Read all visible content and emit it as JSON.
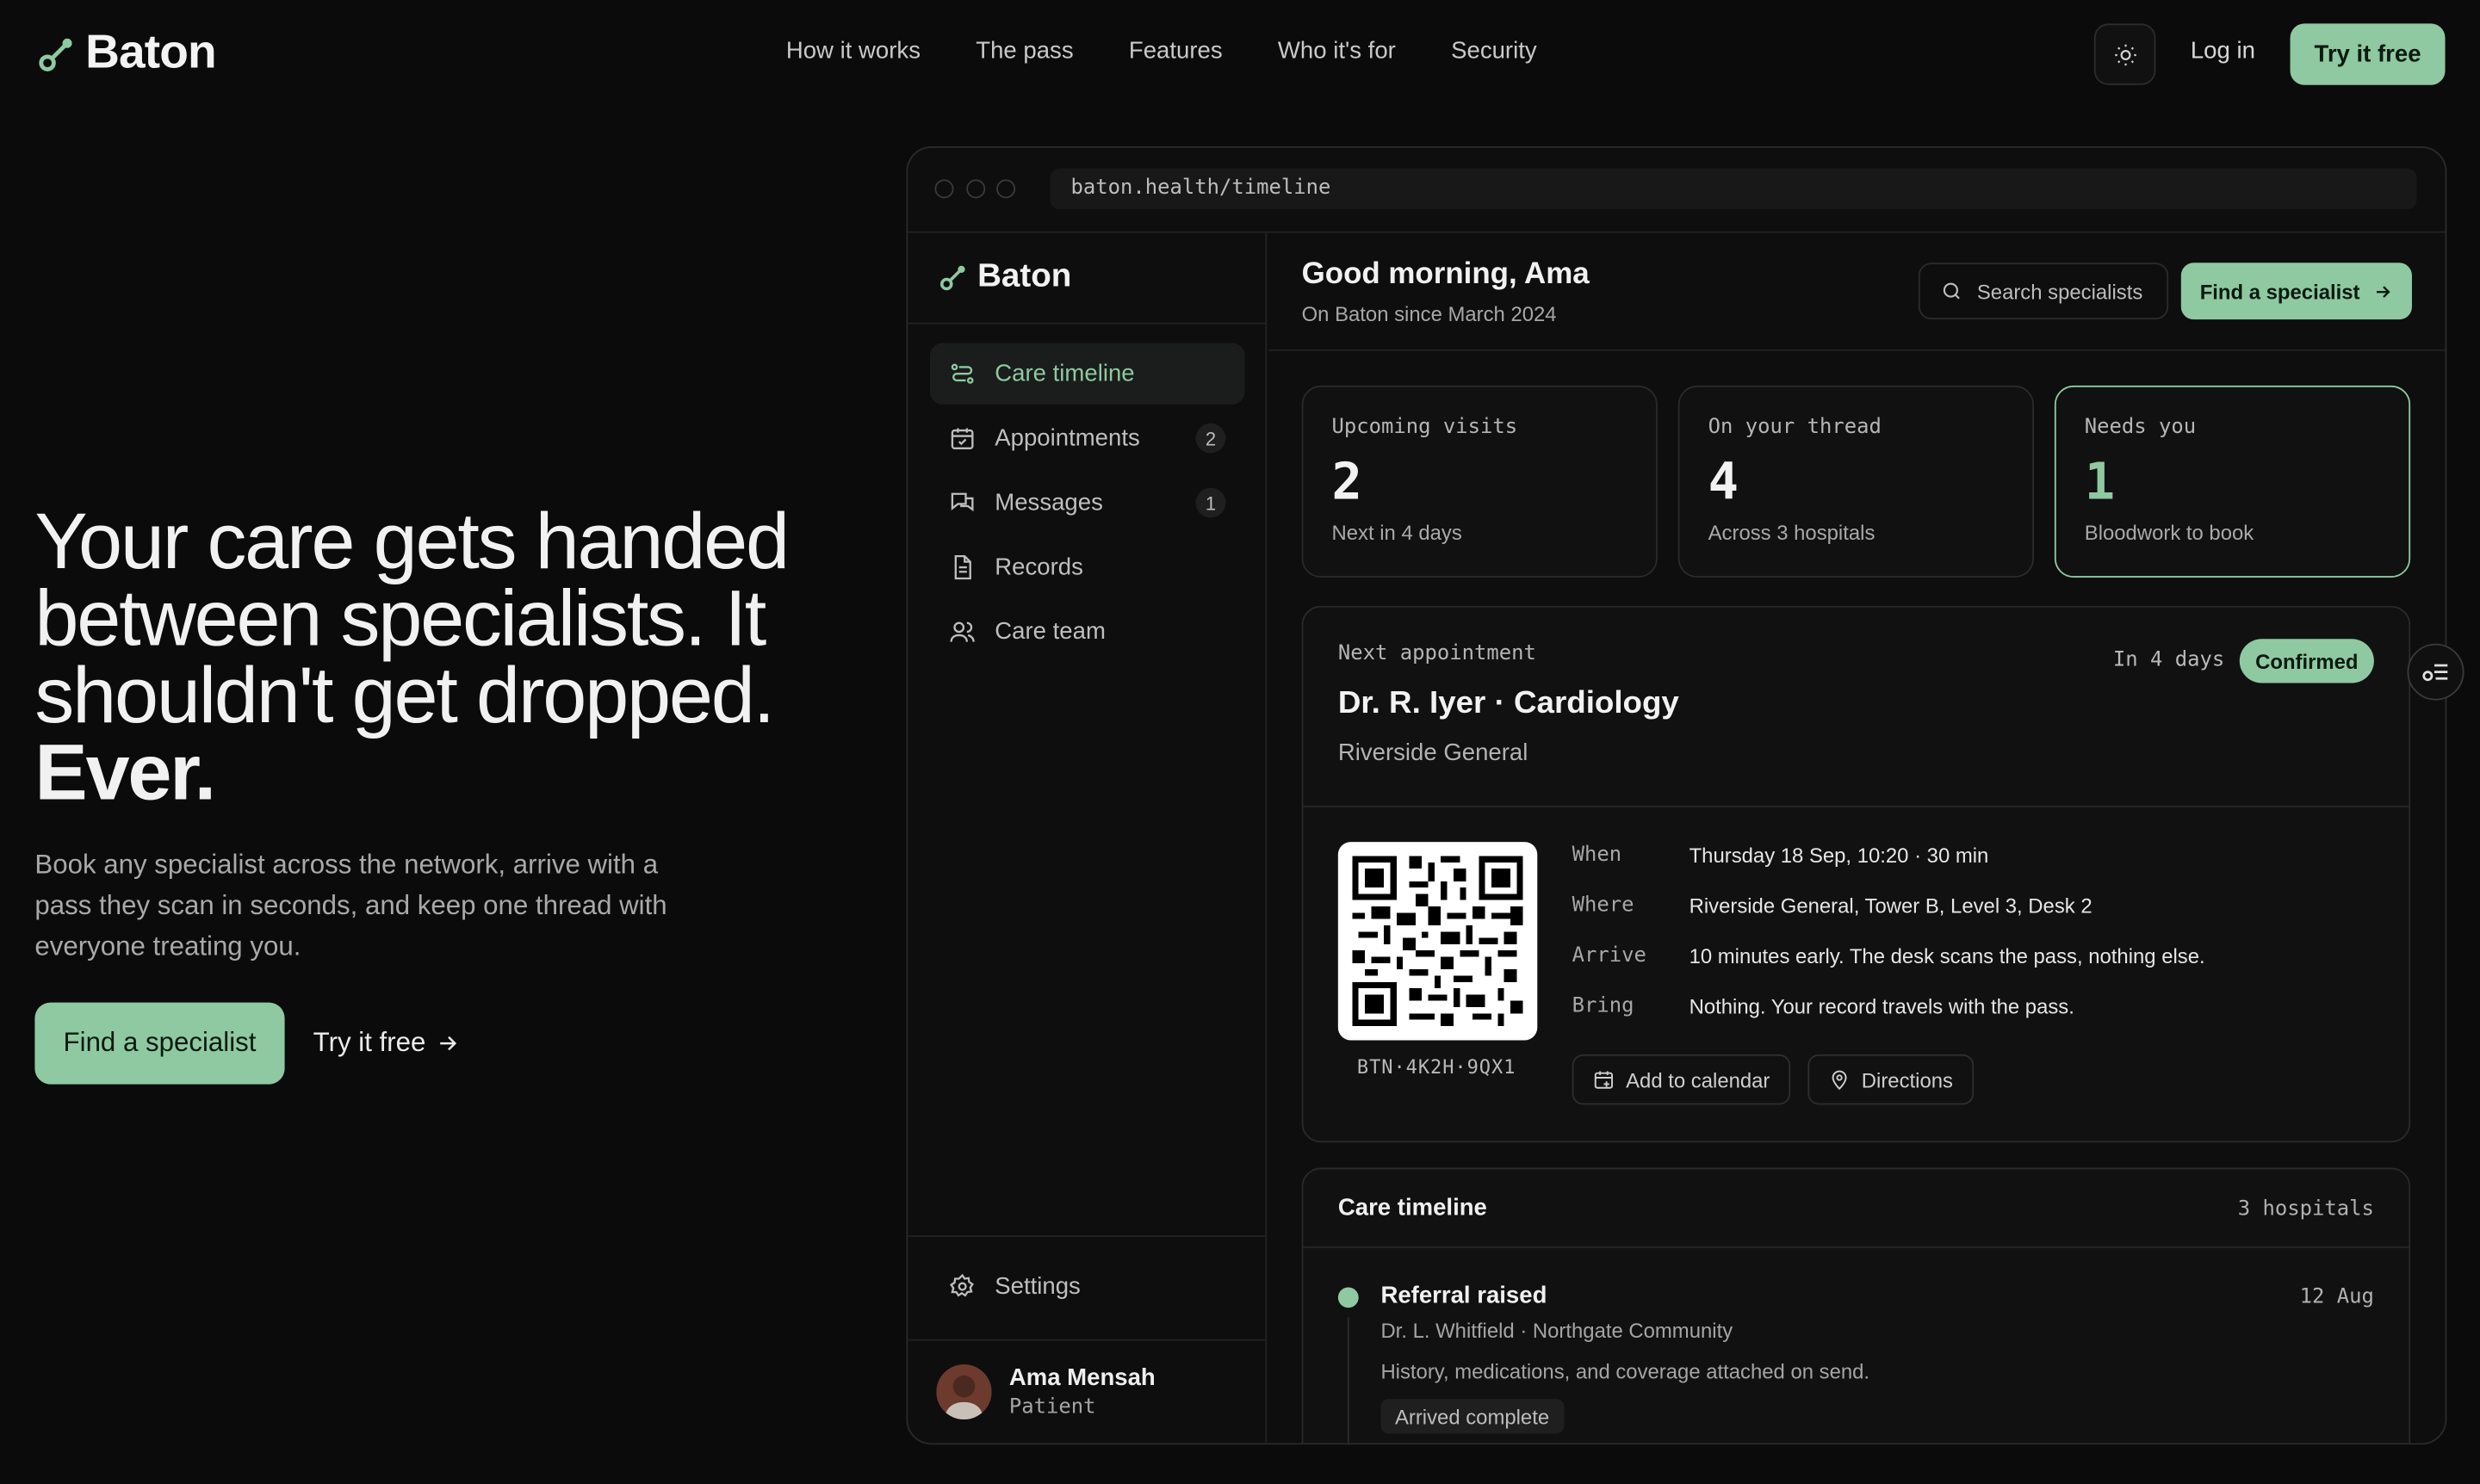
{
  "nav": {
    "brand": "Baton",
    "links": [
      "How it works",
      "The pass",
      "Features",
      "Who it's for",
      "Security"
    ],
    "login": "Log in",
    "try": "Try it free"
  },
  "hero": {
    "title_line": "Your care gets handed between specialists. It shouldn't get dropped.",
    "title_emph": "Ever.",
    "subtitle": "Book any specialist across the network, arrive with a pass they scan in seconds, and keep one thread with everyone treating you.",
    "cta": "Find a specialist",
    "link": "Try it free"
  },
  "window": {
    "url": "baton.health/timeline"
  },
  "sidebar": {
    "brand": "Baton",
    "items": [
      {
        "label": "Care timeline",
        "icon": "timeline-icon",
        "badge": ""
      },
      {
        "label": "Appointments",
        "icon": "calendar-icon",
        "badge": "2"
      },
      {
        "label": "Messages",
        "icon": "messages-icon",
        "badge": "1"
      },
      {
        "label": "Records",
        "icon": "document-icon",
        "badge": ""
      },
      {
        "label": "Care team",
        "icon": "people-icon",
        "badge": ""
      }
    ],
    "settings": "Settings",
    "user": {
      "name": "Ama Mensah",
      "role": "Patient"
    }
  },
  "main": {
    "greeting": "Good morning, Ama",
    "since": "On Baton since March 2024",
    "search_placeholder": "Search specialists",
    "find_label": "Find a specialist",
    "stats": [
      {
        "label": "Upcoming visits",
        "value": "2",
        "note": "Next in 4 days"
      },
      {
        "label": "On your thread",
        "value": "4",
        "note": "Across 3 hospitals"
      },
      {
        "label": "Needs you",
        "value": "1",
        "note": "Bloodwork to book"
      }
    ],
    "appointment": {
      "label": "Next appointment",
      "title": "Dr. R. Iyer · Cardiology",
      "place": "Riverside General",
      "when_short": "In 4 days",
      "status": "Confirmed",
      "pass_code": "BTN·4K2H·9QX1",
      "details": [
        {
          "k": "When",
          "v": "Thursday 18 Sep, 10:20 · 30 min"
        },
        {
          "k": "Where",
          "v": "Riverside General, Tower B, Level 3, Desk 2"
        },
        {
          "k": "Arrive",
          "v": "10 minutes early. The desk scans the pass, nothing else."
        },
        {
          "k": "Bring",
          "v": "Nothing. Your record travels with the pass."
        }
      ],
      "add_calendar": "Add to calendar",
      "directions": "Directions"
    },
    "timeline": {
      "title": "Care timeline",
      "count": "3 hospitals",
      "entries": [
        {
          "title": "Referral raised",
          "date": "12 Aug",
          "who": "Dr. L. Whitfield · Northgate Community",
          "note": "History, medications, and coverage attached on send.",
          "tag": "Arrived complete"
        }
      ]
    }
  },
  "colors": {
    "accent": "#8ec9a1",
    "background": "#0b0b0b"
  }
}
